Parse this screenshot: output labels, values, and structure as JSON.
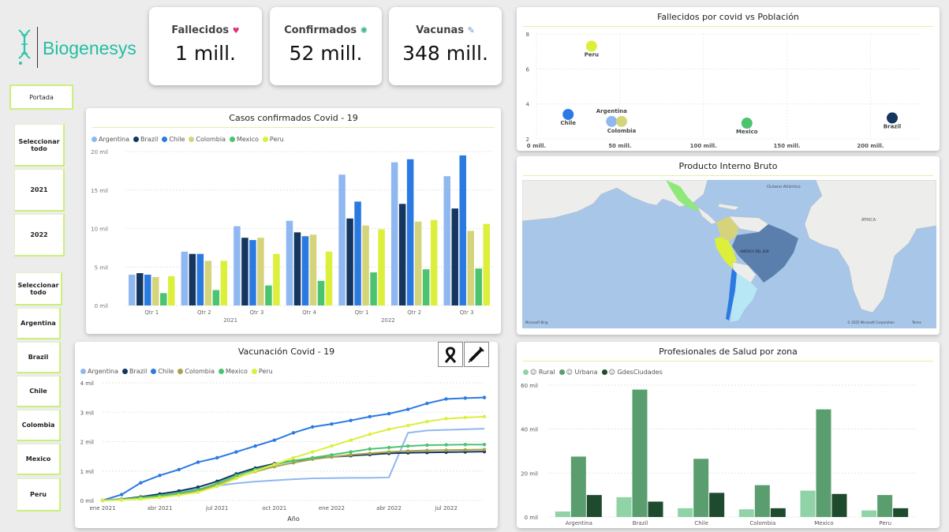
{
  "brand": {
    "name": "Biogenesys",
    "logo_icon": "dna-icon"
  },
  "kpis": [
    {
      "label": "Fallecidos",
      "value": "1 mill.",
      "icon": "heart-icon",
      "icon_color": "#e0317a"
    },
    {
      "label": "Confirmados",
      "value": "52 mill.",
      "icon": "virus-icon",
      "icon_color": "#3bb58a"
    },
    {
      "label": "Vacunas",
      "value": "348 mill.",
      "icon": "syringe-icon",
      "icon_color": "#6b8fd6"
    }
  ],
  "nav": {
    "portada_label": "Portada"
  },
  "year_slicer": [
    "Seleccionar todo",
    "2021",
    "2022"
  ],
  "country_slicer": [
    "Seleccionar todo",
    "Argentina",
    "Brazil",
    "Chile",
    "Colombia",
    "Mexico",
    "Peru"
  ],
  "colors": {
    "Argentina": "#8fb8f0",
    "Brazil": "#15365f",
    "Chile": "#2a7ae2",
    "Colombia": "#d6d47a",
    "Mexico": "#4cc46f",
    "Peru": "#dcef3a"
  },
  "casos": {
    "title": "Casos confirmados Covid - 19",
    "legend": [
      "Argentina",
      "Brazil",
      "Chile",
      "Colombia",
      "Mexico",
      "Peru"
    ],
    "y_ticks": [
      "0 mil",
      "5 mil",
      "10 mil",
      "15 mil",
      "20 mil"
    ],
    "year_labels": [
      "2021",
      "2022"
    ]
  },
  "vacunacion": {
    "title": "Vacunación Covid - 19",
    "legend": [
      "Argentina",
      "Brazil",
      "Chile",
      "Colombia",
      "Mexico",
      "Peru"
    ],
    "y_ticks": [
      "0 mil",
      "1 mil",
      "2 mil",
      "3 mil",
      "4 mil"
    ],
    "x_ticks": [
      "ene 2021",
      "abr 2021",
      "jul 2021",
      "oct 2021",
      "ene 2022",
      "abr 2022",
      "jul 2022"
    ],
    "x_title": "Año",
    "buttons": [
      {
        "icon": "ribbon-icon"
      },
      {
        "icon": "syringe-icon"
      }
    ]
  },
  "fallecidos": {
    "title": "Fallecidos por covid vs Población",
    "y_ticks": [
      "2",
      "4",
      "6",
      "8"
    ],
    "x_ticks": [
      "0 mill.",
      "50 mill.",
      "100 mill.",
      "150 mill.",
      "200 mill."
    ]
  },
  "pib": {
    "title": "Producto Interno Bruto",
    "map_labels": [
      "Océano Atlántico",
      "ÁFRICA",
      "AMÉRICA DEL SUR"
    ],
    "attribution_left": "Microsoft Bing",
    "attribution_right": "© 2025 Microsoft Corporation",
    "terms": "Terms"
  },
  "profesionales": {
    "title": "Profesionales de Salud por zona",
    "legend": [
      "Rural",
      "Urbana",
      "GdesCiudades"
    ],
    "legend_colors": [
      "#8fd3a6",
      "#5a9e6f",
      "#1e4a2e"
    ],
    "y_ticks": [
      "0 mil",
      "20 mil",
      "40 mil",
      "60 mil"
    ]
  },
  "chart_data": [
    {
      "type": "bar",
      "title": "Casos confirmados Covid - 19",
      "categories": [
        "Qtr 1 2021",
        "Qtr 2 2021",
        "Qtr 3 2021",
        "Qtr 4 2021",
        "Qtr 1 2022",
        "Qtr 2 2022",
        "Qtr 3 2022"
      ],
      "tick_labels": [
        "Qtr 1",
        "Qtr 2",
        "Qtr 3",
        "Qtr 4",
        "Qtr 1",
        "Qtr 2",
        "Qtr 3"
      ],
      "ylim": [
        0,
        20
      ],
      "y_unit": "mil",
      "series": [
        {
          "name": "Argentina",
          "values": [
            4.0,
            7.0,
            10.3,
            11.0,
            17.0,
            18.6,
            16.8
          ]
        },
        {
          "name": "Brazil",
          "values": [
            4.2,
            6.7,
            8.8,
            9.5,
            11.3,
            13.2,
            12.6
          ]
        },
        {
          "name": "Chile",
          "values": [
            4.0,
            6.7,
            8.5,
            9.0,
            13.5,
            19.0,
            19.5
          ]
        },
        {
          "name": "Colombia",
          "values": [
            3.7,
            5.8,
            8.8,
            9.2,
            10.4,
            10.9,
            9.7
          ]
        },
        {
          "name": "Mexico",
          "values": [
            1.6,
            2.0,
            2.6,
            3.2,
            4.3,
            4.7,
            4.8
          ]
        },
        {
          "name": "Peru",
          "values": [
            3.8,
            5.8,
            6.7,
            7.0,
            9.9,
            11.1,
            10.6
          ]
        }
      ]
    },
    {
      "type": "line",
      "title": "Vacunación Covid - 19",
      "x": [
        "ene 2021",
        "feb 2021",
        "mar 2021",
        "abr 2021",
        "may 2021",
        "jun 2021",
        "jul 2021",
        "ago 2021",
        "sep 2021",
        "oct 2021",
        "nov 2021",
        "dic 2021",
        "ene 2022",
        "feb 2022",
        "mar 2022",
        "abr 2022",
        "may 2022",
        "jun 2022",
        "jul 2022",
        "ago 2022",
        "sep 2022"
      ],
      "xlabel": "Año",
      "ylim": [
        0,
        4
      ],
      "y_unit": "mil",
      "series": [
        {
          "name": "Argentina",
          "values": [
            0.0,
            0.05,
            0.12,
            0.18,
            0.28,
            0.38,
            0.5,
            0.58,
            0.64,
            0.68,
            0.72,
            0.75,
            0.76,
            0.77,
            0.77,
            0.78,
            2.3,
            2.38,
            2.4,
            2.42,
            2.44
          ]
        },
        {
          "name": "Brazil",
          "values": [
            0.0,
            0.04,
            0.12,
            0.22,
            0.32,
            0.45,
            0.65,
            0.9,
            1.1,
            1.25,
            1.35,
            1.42,
            1.48,
            1.52,
            1.56,
            1.6,
            1.62,
            1.63,
            1.64,
            1.65,
            1.66
          ]
        },
        {
          "name": "Chile",
          "values": [
            0.0,
            0.2,
            0.6,
            0.85,
            1.05,
            1.3,
            1.45,
            1.65,
            1.85,
            2.05,
            2.3,
            2.5,
            2.6,
            2.72,
            2.85,
            2.95,
            3.1,
            3.3,
            3.45,
            3.48,
            3.5
          ]
        },
        {
          "name": "Colombia",
          "values": [
            0.0,
            0.02,
            0.08,
            0.15,
            0.22,
            0.32,
            0.52,
            0.78,
            0.98,
            1.15,
            1.28,
            1.4,
            1.48,
            1.55,
            1.6,
            1.65,
            1.68,
            1.7,
            1.71,
            1.72,
            1.73
          ]
        },
        {
          "name": "Mexico",
          "values": [
            0.0,
            0.03,
            0.1,
            0.16,
            0.24,
            0.36,
            0.58,
            0.85,
            1.05,
            1.22,
            1.35,
            1.45,
            1.55,
            1.65,
            1.75,
            1.8,
            1.85,
            1.88,
            1.89,
            1.9,
            1.9
          ]
        },
        {
          "name": "Peru",
          "values": [
            0.0,
            0.02,
            0.05,
            0.1,
            0.18,
            0.28,
            0.48,
            0.75,
            1.0,
            1.22,
            1.45,
            1.65,
            1.85,
            2.05,
            2.25,
            2.42,
            2.55,
            2.68,
            2.78,
            2.82,
            2.85
          ]
        }
      ]
    },
    {
      "type": "scatter",
      "title": "Fallecidos por covid vs Población",
      "xlim": [
        0,
        210
      ],
      "x_unit": "mill.",
      "ylim": [
        2,
        8
      ],
      "points": [
        {
          "name": "Peru",
          "x": 33,
          "y": 7.3
        },
        {
          "name": "Chile",
          "x": 19,
          "y": 3.4
        },
        {
          "name": "Argentina",
          "x": 45,
          "y": 3.0
        },
        {
          "name": "Colombia",
          "x": 51,
          "y": 3.0
        },
        {
          "name": "Mexico",
          "x": 126,
          "y": 2.9
        },
        {
          "name": "Brazil",
          "x": 213,
          "y": 3.2
        }
      ]
    },
    {
      "type": "bar",
      "title": "Profesionales de Salud por zona",
      "categories": [
        "Argentina",
        "Brazil",
        "Chile",
        "Colombia",
        "Mexico",
        "Peru"
      ],
      "ylim": [
        0,
        60
      ],
      "y_unit": "mil",
      "series": [
        {
          "name": "Rural",
          "values": [
            2.5,
            9,
            4,
            3.5,
            12,
            3
          ]
        },
        {
          "name": "Urbana",
          "values": [
            27.5,
            58,
            26.5,
            14.5,
            49,
            10
          ]
        },
        {
          "name": "GdesCiudades",
          "values": [
            10,
            7,
            11,
            4,
            10.5,
            4
          ]
        }
      ]
    }
  ]
}
